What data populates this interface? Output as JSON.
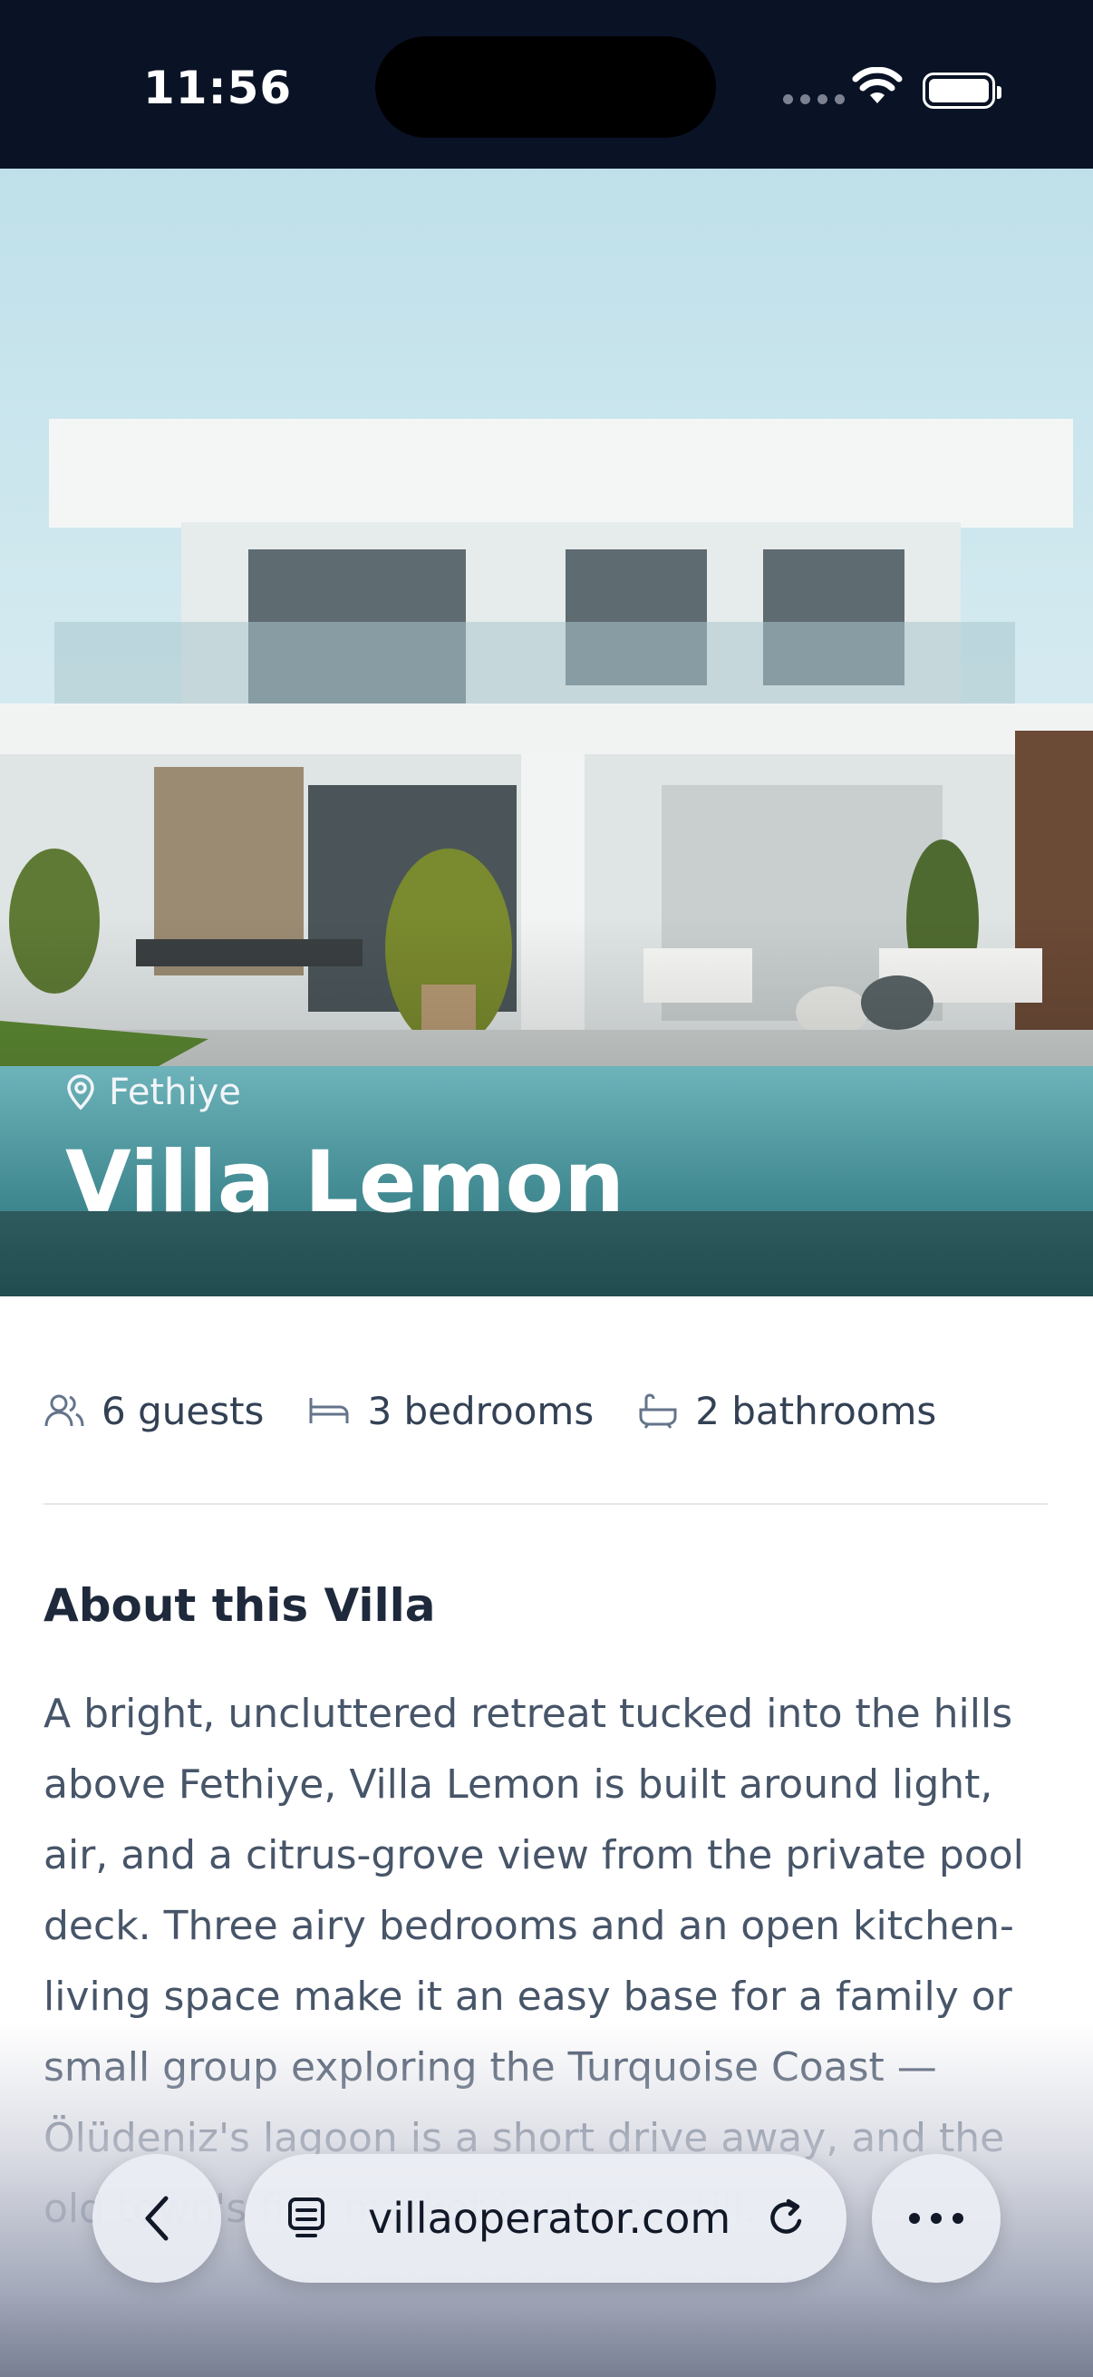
{
  "status_bar": {
    "time": "11:56"
  },
  "hero": {
    "location": "Fethiye",
    "title": "Villa Lemon",
    "image_description_icon": "villa-photo"
  },
  "amenities": [
    {
      "icon": "guests-icon",
      "label": "6 guests"
    },
    {
      "icon": "bed-icon",
      "label": "3 bedrooms"
    },
    {
      "icon": "bath-icon",
      "label": "2 bathrooms"
    }
  ],
  "about": {
    "title": "About this Villa",
    "body": "A bright, uncluttered retreat tucked into the hills above Fethiye, Villa Lemon is built around light, air, and a citrus-grove view from the private pool deck. Three airy bedrooms and an open kitchen-living space make it an easy base for a family or small group exploring the Turquoise Coast — Ölüdeniz's lagoon is a short drive away, and the old town's fish market is closer still."
  },
  "browser": {
    "url": "villaoperator.com"
  },
  "colors": {
    "status_bar_bg": "#0a1226",
    "text_primary": "#1e293b",
    "text_secondary": "#475569"
  }
}
